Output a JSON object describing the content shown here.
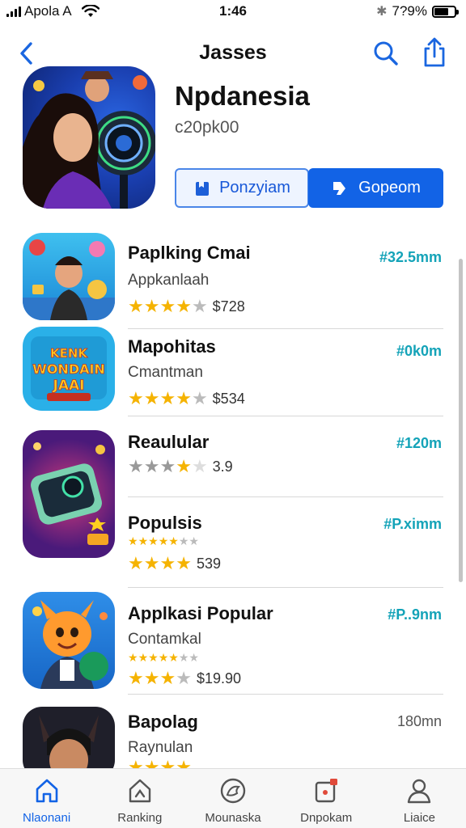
{
  "status_bar": {
    "carrier": "Apola A",
    "time": "1:46",
    "battery_percent_text": "7?9%"
  },
  "nav": {
    "title": "Jasses",
    "back_icon": "chevron-left-icon",
    "search_icon": "search-icon",
    "share_icon": "share-icon"
  },
  "featured": {
    "title": "Npdanesia",
    "subtitle": "c20pk00",
    "button_outline_label": "Ponzyiam",
    "button_fill_label": "Gopeom",
    "accent_color": "#1263e6"
  },
  "apps": [
    {
      "name": "Paplking Cmai",
      "category": "Appkanlaah",
      "stars": 4,
      "rating_text": "$728",
      "price": "#32.5mm"
    },
    {
      "name": "Mapohitas",
      "category": "Cmantman",
      "stars": 4,
      "rating_text": "$534",
      "price": "#0k0m"
    },
    {
      "name": "Reaulular",
      "category": "",
      "stars": 4,
      "rating_text": "3.9",
      "price": "#120m"
    },
    {
      "name": "Populsis",
      "category": "",
      "stars": 4,
      "rating_text": "539",
      "price": "#P.ximm"
    },
    {
      "name": "Applkasi Popular",
      "category": "Contamkal",
      "stars": 3,
      "rating_text": "$19.90",
      "price": "#P..9nm"
    },
    {
      "name": "Bapolag",
      "category": "Raynulan",
      "stars": 4,
      "rating_text": "",
      "price": "180mn"
    }
  ],
  "tab_bar": {
    "tabs": [
      {
        "label": "Nlaonani",
        "icon": "home-icon",
        "active": true
      },
      {
        "label": "Ranking",
        "icon": "ranking-icon",
        "active": false
      },
      {
        "label": "Mounaska",
        "icon": "discover-icon",
        "active": false
      },
      {
        "label": "Dnpokam",
        "icon": "updates-icon",
        "active": false
      },
      {
        "label": "Liaice",
        "icon": "profile-icon",
        "active": false
      }
    ]
  }
}
